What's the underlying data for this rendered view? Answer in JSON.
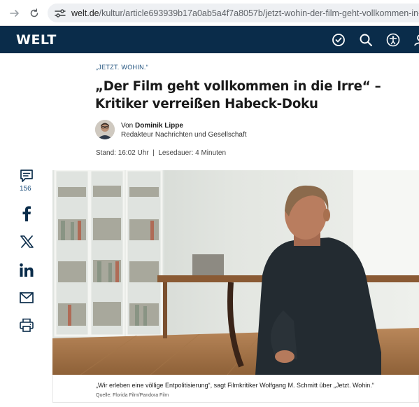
{
  "browser": {
    "url_host": "welt.de",
    "url_path": "/kultur/article693939b17a0ab5a4f7a8057b/jetzt-wohin-der-film-geht-vollkommen-in-die-"
  },
  "site": {
    "logo": "WELT",
    "brand_color": "#0a2c4a"
  },
  "article": {
    "kicker": "„JETZT. WOHIN.“",
    "headline": "„Der Film geht vollkommen in die Irre“ – Kritiker verreißen Habeck-Doku",
    "author_prefix": "Von ",
    "author_name": "Dominik Lippe",
    "author_role": "Redakteur Nachrichten und Gesellschaft",
    "meta": "Stand: 16:02 Uhr  |  Lesedauer: 4 Minuten"
  },
  "social": {
    "comment_count": "156",
    "icons": [
      "comment-icon",
      "facebook-icon",
      "x-icon",
      "linkedin-icon",
      "mail-icon",
      "print-icon"
    ]
  },
  "image": {
    "caption": "„Wir erleben eine völlige Entpolitisierung“, sagt Filmkritiker Wolfgang M. Schmitt über „Jetzt. Wohin.“",
    "credit": "Quelle: Florida Film/Pandora Film"
  }
}
